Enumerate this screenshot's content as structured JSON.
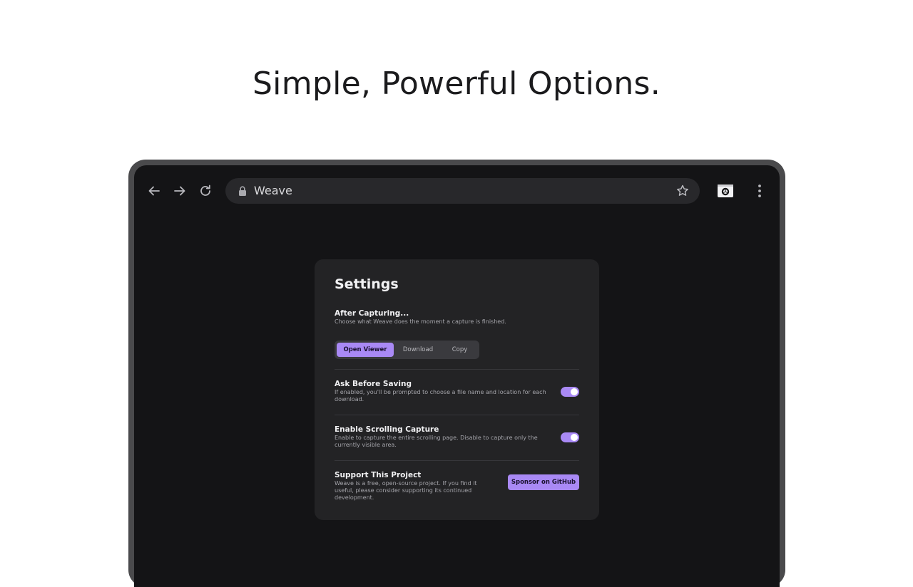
{
  "headline": "Simple, Powerful Options.",
  "browser": {
    "url_text": "Weave",
    "icons": {
      "back": "arrow-left-icon",
      "forward": "arrow-right-icon",
      "reload": "reload-icon",
      "lock": "lock-icon",
      "bookmark": "star-icon",
      "extension": "camera-shutter-icon",
      "menu": "kebab-menu-icon"
    }
  },
  "settings": {
    "title": "Settings",
    "after_capturing": {
      "title": "After Capturing...",
      "description": "Choose what Weave does the moment a capture is finished.",
      "options": [
        "Open Viewer",
        "Download",
        "Copy"
      ],
      "selected": "Open Viewer"
    },
    "ask_before_saving": {
      "title": "Ask Before Saving",
      "description": "If enabled, you'll be prompted to choose a file name and location for each download.",
      "enabled": true
    },
    "scrolling_capture": {
      "title": "Enable Scrolling Capture",
      "description": "Enable to capture the entire scrolling page. Disable to capture only the currently visible area.",
      "enabled": true
    },
    "support": {
      "title": "Support This Project",
      "description": "Weave is a free, open-source project. If you find it useful, please consider supporting its continued development.",
      "button_label": "Sponsor on GitHub"
    }
  },
  "colors": {
    "accent": "#a989f5",
    "page_background": "#ffffff",
    "browser_background": "#141416",
    "panel_background": "#232325",
    "device_frame": "#4a4a4c"
  }
}
